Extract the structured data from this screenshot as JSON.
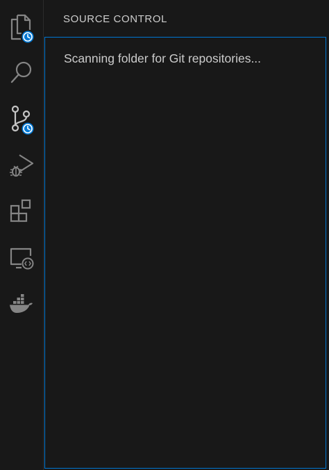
{
  "activity_bar": {
    "items": [
      {
        "icon": "explorer-files-icon",
        "badge": "clock-badge-icon"
      },
      {
        "icon": "search-icon"
      },
      {
        "icon": "source-control-icon",
        "badge": "clock-badge-icon"
      },
      {
        "icon": "run-debug-icon"
      },
      {
        "icon": "extensions-icon"
      },
      {
        "icon": "remote-explorer-icon"
      },
      {
        "icon": "docker-icon"
      }
    ],
    "badge_color": "#0078d4"
  },
  "panel": {
    "title": "SOURCE CONTROL",
    "message": "Scanning folder for Git repositories..."
  },
  "colors": {
    "background": "#181818",
    "icon": "#858585",
    "text": "#cccccc",
    "focus_border": "#0078d4"
  }
}
